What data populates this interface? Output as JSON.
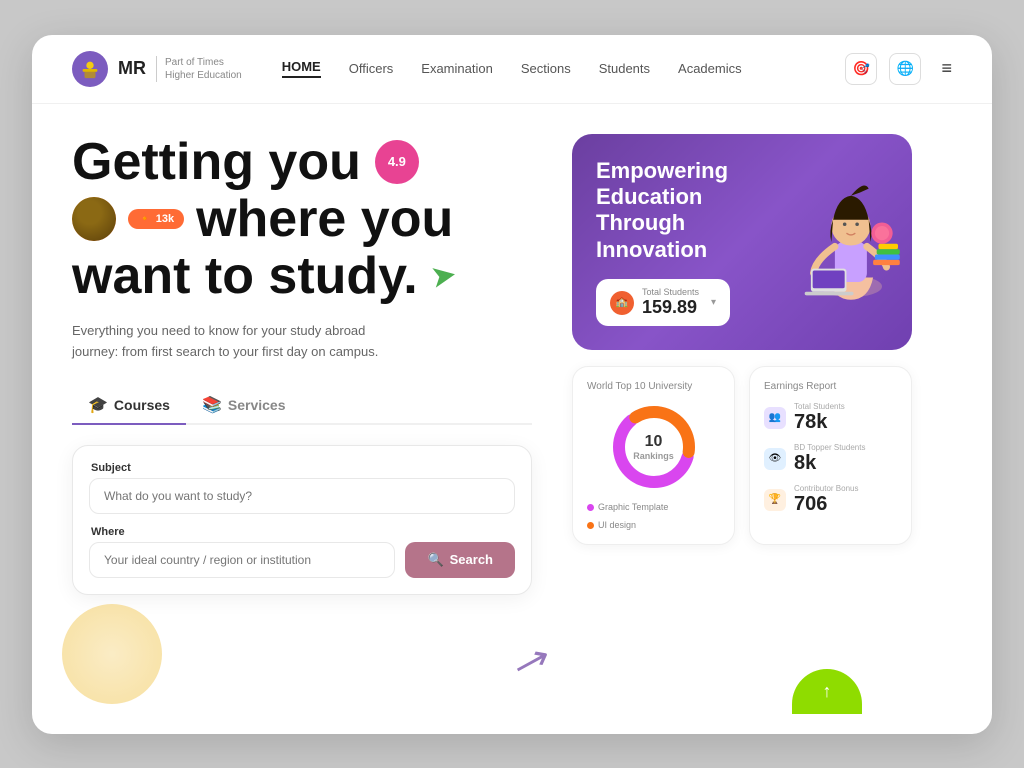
{
  "meta": {
    "background_color": "#c8c8c8"
  },
  "navbar": {
    "logo_text": "MR",
    "logo_subtitle_line1": "Part of Times",
    "logo_subtitle_line2": "Higher Education",
    "links": [
      {
        "label": "HOME",
        "active": true
      },
      {
        "label": "Officers",
        "active": false
      },
      {
        "label": "Examination",
        "active": false
      },
      {
        "label": "Sections",
        "active": false
      },
      {
        "label": "Students",
        "active": false
      },
      {
        "label": "Academics",
        "active": false
      }
    ],
    "icon1": "🎯",
    "icon2": "🌐"
  },
  "hero": {
    "line1": "Getting you",
    "rating": "4.9",
    "line2": "where you",
    "tag": "13k",
    "line3": "want to study.",
    "subtitle": "Everything you need to know for your study abroad journey: from first search to your first day on campus."
  },
  "tabs": [
    {
      "label": "Courses",
      "icon": "🎓",
      "active": true
    },
    {
      "label": "Services",
      "icon": "📚",
      "active": false
    }
  ],
  "form": {
    "subject_label": "Subject",
    "subject_placeholder": "What do you want to study?",
    "where_label": "Where",
    "where_placeholder": "Your ideal country / region or institution",
    "search_button": "Search"
  },
  "purple_card": {
    "title": "Empowering Education Through Innovation",
    "badge_label": "Total Students",
    "badge_value": "159.89"
  },
  "donut_chart": {
    "title": "World Top 10 University",
    "center_value": "10",
    "center_label": "Rankings",
    "legend": [
      {
        "label": "Graphic Template",
        "color": "#d946ef"
      },
      {
        "label": "UI design",
        "color": "#f97316"
      }
    ]
  },
  "earnings": {
    "title": "Earnings Report",
    "items": [
      {
        "label": "Total Students",
        "value": "78k",
        "icon_bg": "#e8e0ff",
        "icon_color": "#7c5cbf",
        "icon": "👥"
      },
      {
        "label": "BD Topper Students",
        "value": "8k",
        "icon_bg": "#e0f0ff",
        "icon_color": "#2563eb",
        "icon": "👁"
      },
      {
        "label": "Contributor Bonus",
        "value": "706",
        "icon_bg": "#fff0e0",
        "icon_color": "#f97316",
        "icon": "🏆"
      }
    ]
  }
}
